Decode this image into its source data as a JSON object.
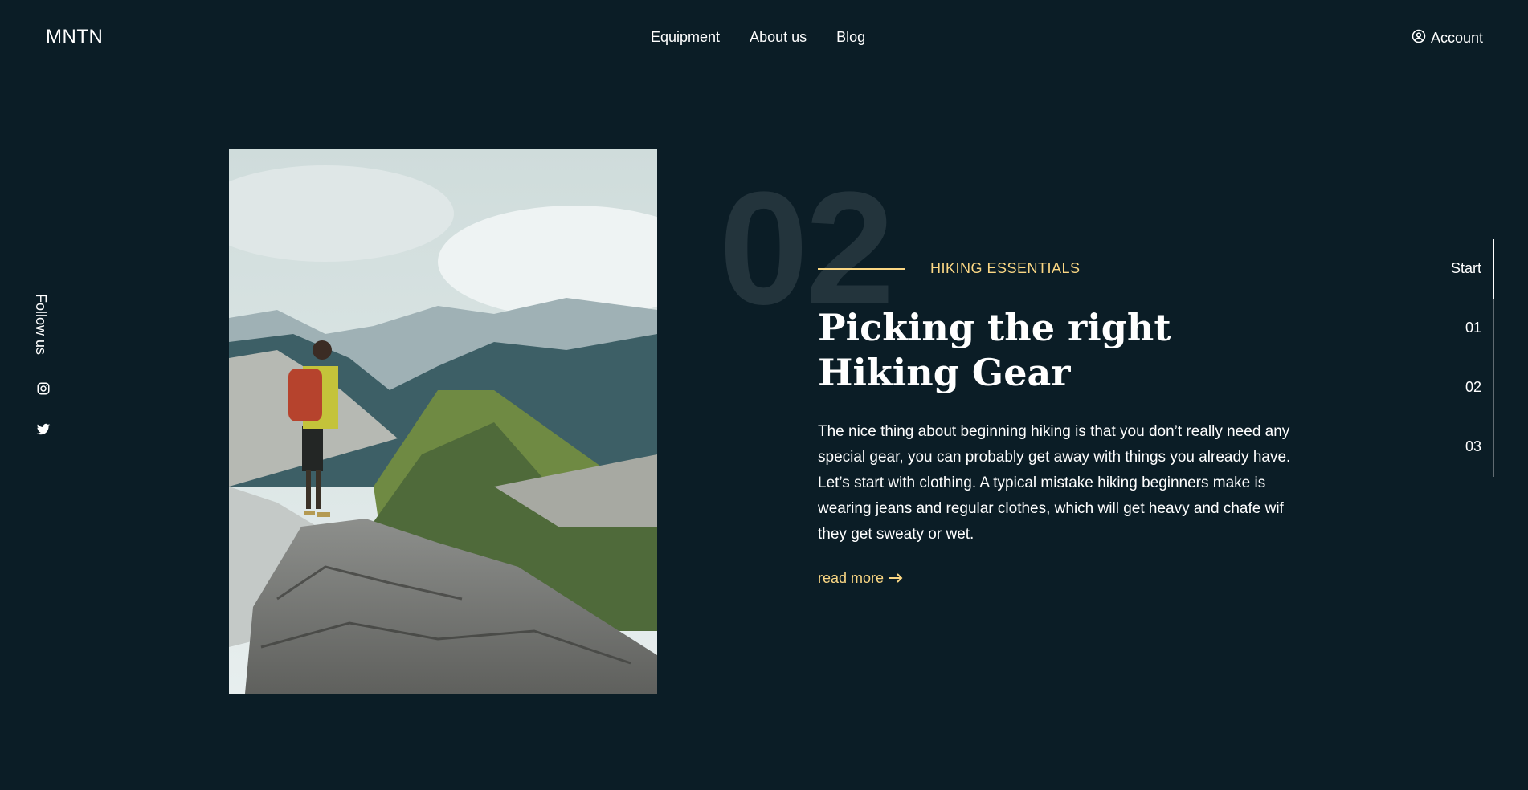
{
  "brand": {
    "logo": "MNTN"
  },
  "nav": {
    "items": [
      "Equipment",
      "About us",
      "Blog"
    ]
  },
  "account": {
    "label": "Account",
    "icon": "user-circle-icon"
  },
  "social": {
    "label": "Follow us",
    "icons": [
      "instagram-icon",
      "twitter-icon"
    ]
  },
  "section": {
    "number": "02",
    "eyebrow": "HIKING ESSENTIALS",
    "headline_line1": "Picking the right",
    "headline_line2": "Hiking Gear",
    "body": "The nice thing about beginning hiking is that you don’t really need any special gear, you can probably get away with things you already have. Let’s start with clothing. A typical mistake hiking beginners make is wearing jeans and regular clothes, which will get heavy and chafe wif they get sweaty or wet.",
    "read_more": "read more",
    "read_more_icon": "arrow-right-icon"
  },
  "steps": {
    "items": [
      "Start",
      "01",
      "02",
      "03"
    ],
    "active_index": 0
  },
  "colors": {
    "background": "#0b1d26",
    "accent": "#fbd784",
    "text": "#ffffff"
  }
}
